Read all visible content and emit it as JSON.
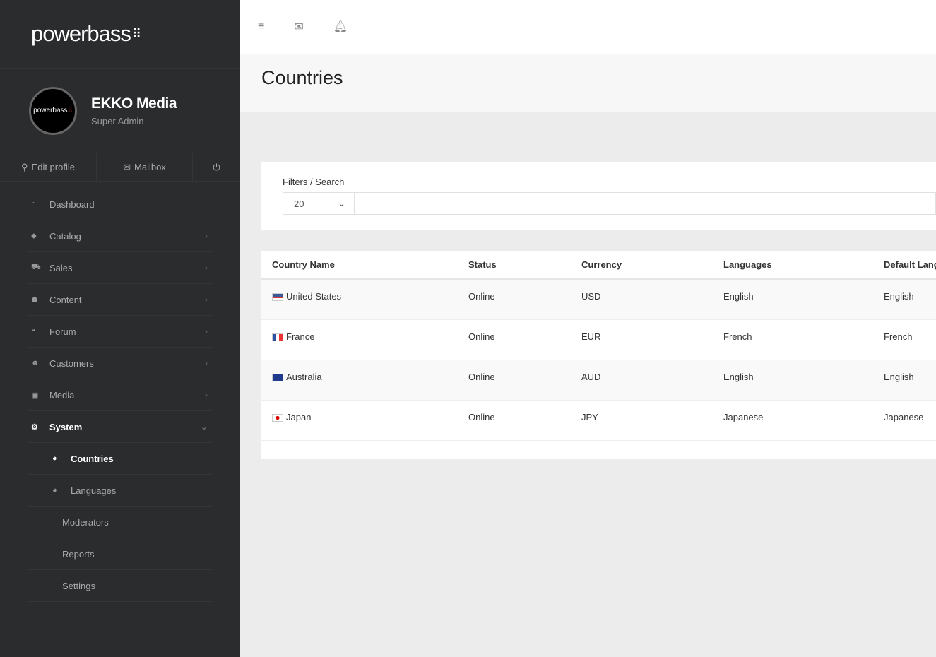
{
  "brand": {
    "logo": "powerbass",
    "avatar_text": "powerbass"
  },
  "profile": {
    "name": "EKKO Media",
    "role": "Super Admin",
    "edit": "Edit profile",
    "mailbox": "Mailbox"
  },
  "nav": [
    {
      "label": "Dashboard",
      "icon": "home-icon",
      "chev": ""
    },
    {
      "label": "Catalog",
      "icon": "tags-icon",
      "chev": "›"
    },
    {
      "label": "Sales",
      "icon": "cart-icon",
      "chev": "›"
    },
    {
      "label": "Content",
      "icon": "sitemap-icon",
      "chev": "›"
    },
    {
      "label": "Forum",
      "icon": "comments-icon",
      "chev": "›"
    },
    {
      "label": "Customers",
      "icon": "users-icon",
      "chev": "›"
    },
    {
      "label": "Media",
      "icon": "images-icon",
      "chev": "›"
    },
    {
      "label": "System",
      "icon": "gears-icon",
      "chev": "⌄"
    }
  ],
  "subnav": [
    {
      "label": "Countries"
    },
    {
      "label": "Languages"
    },
    {
      "label": "Moderators"
    },
    {
      "label": "Reports"
    },
    {
      "label": "Settings"
    }
  ],
  "page": {
    "title": "Countries"
  },
  "filters": {
    "label": "Filters / Search",
    "per_page": "20",
    "search_value": ""
  },
  "table": {
    "headers": [
      "Country Name",
      "Status",
      "Currency",
      "Languages",
      "Default Language"
    ],
    "rows": [
      {
        "flag": "us",
        "name": "United States",
        "status": "Online",
        "currency": "USD",
        "languages": "English",
        "default": "English"
      },
      {
        "flag": "fr",
        "name": "France",
        "status": "Online",
        "currency": "EUR",
        "languages": "French",
        "default": "French"
      },
      {
        "flag": "au",
        "name": "Australia",
        "status": "Online",
        "currency": "AUD",
        "languages": "English",
        "default": "English"
      },
      {
        "flag": "jp",
        "name": "Japan",
        "status": "Online",
        "currency": "JPY",
        "languages": "Japanese",
        "default": "Japanese"
      }
    ]
  }
}
